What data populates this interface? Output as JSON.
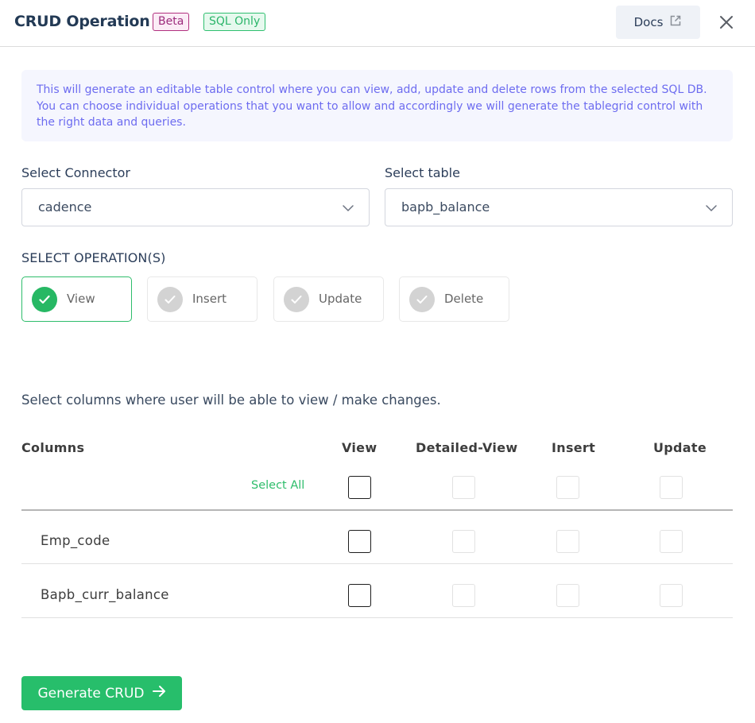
{
  "header": {
    "title": "CRUD Operation",
    "badges": [
      {
        "label": "Beta",
        "color": "#b1307f"
      },
      {
        "label": "SQL Only",
        "color": "#2fbf6f"
      }
    ],
    "docs_label": "Docs",
    "docs_icon": "external-link-icon",
    "close_icon": "close-icon"
  },
  "info": {
    "text": "This will generate an editable table control where you can view, add, update and delete rows from the selected SQL DB. You can choose individual operations that you want to allow and accordingly we will generate the tablegrid control with the right data and queries."
  },
  "connector": {
    "label": "Select Connector",
    "value": "cadence"
  },
  "table": {
    "label": "Select table",
    "value": "bapb_balance"
  },
  "operations": {
    "heading": "SELECT OPERATION(S)",
    "items": [
      {
        "label": "View",
        "selected": true
      },
      {
        "label": "Insert",
        "selected": false
      },
      {
        "label": "Update",
        "selected": false
      },
      {
        "label": "Delete",
        "selected": false
      }
    ]
  },
  "columns": {
    "description": "Select columns where user will be able to view / make changes.",
    "headers": [
      "Columns",
      "View",
      "Detailed-View",
      "Insert",
      "Update"
    ],
    "select_all_label": "Select All",
    "select_all": {
      "view": false,
      "detailed_view": false,
      "insert": false,
      "update": false
    },
    "rows": [
      {
        "name": "Emp_code",
        "view": false,
        "detailed_view": false,
        "insert": false,
        "update": false
      },
      {
        "name": "Bapb_curr_balance",
        "view": false,
        "detailed_view": false,
        "insert": false,
        "update": false
      }
    ]
  },
  "footer": {
    "generate_label": "Generate CRUD",
    "generate_icon": "arrow-right-icon"
  },
  "colors": {
    "accent_green": "#27be6b",
    "info_text": "#6d6cf0",
    "info_bg": "#f5f6fe"
  }
}
